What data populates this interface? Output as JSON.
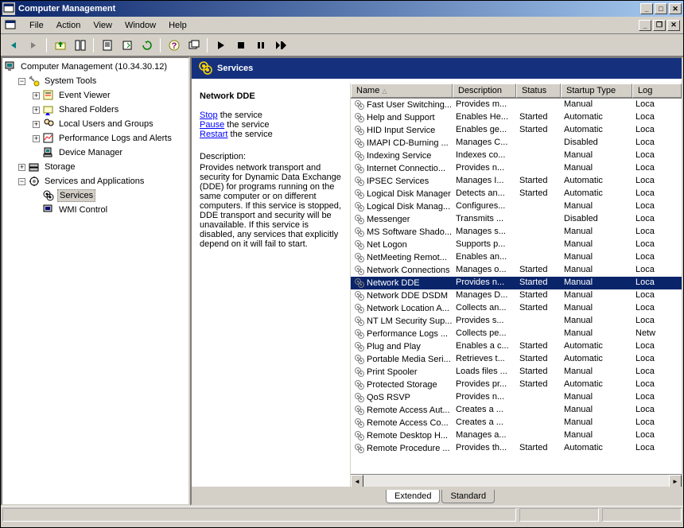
{
  "window": {
    "title": "Computer Management"
  },
  "mdi": {
    "minimize": "_",
    "restore": "❐",
    "close": "✕"
  },
  "titlebar_buttons": {
    "minimize": "_",
    "maximize": "□",
    "close": "✕"
  },
  "menu": {
    "file": "File",
    "action": "Action",
    "view": "View",
    "window": "Window",
    "help": "Help"
  },
  "tree": {
    "root": "Computer Management (10.34.30.12)",
    "system_tools": "System Tools",
    "event_viewer": "Event Viewer",
    "shared_folders": "Shared Folders",
    "local_users": "Local Users and Groups",
    "perf_logs": "Performance Logs and Alerts",
    "device_mgr": "Device Manager",
    "storage": "Storage",
    "services_apps": "Services and Applications",
    "services": "Services",
    "wmi": "WMI Control"
  },
  "header": {
    "title": "Services"
  },
  "detail": {
    "title": "Network DDE",
    "stop": "Stop",
    "stop_suffix": " the service",
    "pause": "Pause",
    "pause_suffix": " the service",
    "restart": "Restart",
    "restart_suffix": " the service",
    "desc_label": "Description:",
    "description": "Provides network transport and security for Dynamic Data Exchange (DDE) for programs running on the same computer or on different computers. If this service is stopped, DDE transport and security will be unavailable. If this service is disabled, any services that explicitly depend on it will fail to start."
  },
  "columns": {
    "name": "Name",
    "description": "Description",
    "status": "Status",
    "startup": "Startup Type",
    "logon": "Log"
  },
  "tabs": {
    "extended": "Extended",
    "standard": "Standard"
  },
  "services": [
    {
      "name": "Fast User Switching...",
      "desc": "Provides m...",
      "status": "",
      "startup": "Manual",
      "logon": "Loca"
    },
    {
      "name": "Help and Support",
      "desc": "Enables He...",
      "status": "Started",
      "startup": "Automatic",
      "logon": "Loca"
    },
    {
      "name": "HID Input Service",
      "desc": "Enables ge...",
      "status": "Started",
      "startup": "Automatic",
      "logon": "Loca"
    },
    {
      "name": "IMAPI CD-Burning ...",
      "desc": "Manages C...",
      "status": "",
      "startup": "Disabled",
      "logon": "Loca"
    },
    {
      "name": "Indexing Service",
      "desc": "Indexes co...",
      "status": "",
      "startup": "Manual",
      "logon": "Loca"
    },
    {
      "name": "Internet Connectio...",
      "desc": "Provides n...",
      "status": "",
      "startup": "Manual",
      "logon": "Loca"
    },
    {
      "name": "IPSEC Services",
      "desc": "Manages I...",
      "status": "Started",
      "startup": "Automatic",
      "logon": "Loca"
    },
    {
      "name": "Logical Disk Manager",
      "desc": "Detects an...",
      "status": "Started",
      "startup": "Automatic",
      "logon": "Loca"
    },
    {
      "name": "Logical Disk Manag...",
      "desc": "Configures...",
      "status": "",
      "startup": "Manual",
      "logon": "Loca"
    },
    {
      "name": "Messenger",
      "desc": "Transmits ...",
      "status": "",
      "startup": "Disabled",
      "logon": "Loca"
    },
    {
      "name": "MS Software Shado...",
      "desc": "Manages s...",
      "status": "",
      "startup": "Manual",
      "logon": "Loca"
    },
    {
      "name": "Net Logon",
      "desc": "Supports p...",
      "status": "",
      "startup": "Manual",
      "logon": "Loca"
    },
    {
      "name": "NetMeeting Remot...",
      "desc": "Enables an...",
      "status": "",
      "startup": "Manual",
      "logon": "Loca"
    },
    {
      "name": "Network Connections",
      "desc": "Manages o...",
      "status": "Started",
      "startup": "Manual",
      "logon": "Loca"
    },
    {
      "name": "Network DDE",
      "desc": "Provides n...",
      "status": "Started",
      "startup": "Manual",
      "logon": "Loca",
      "selected": true
    },
    {
      "name": "Network DDE DSDM",
      "desc": "Manages D...",
      "status": "Started",
      "startup": "Manual",
      "logon": "Loca"
    },
    {
      "name": "Network Location A...",
      "desc": "Collects an...",
      "status": "Started",
      "startup": "Manual",
      "logon": "Loca"
    },
    {
      "name": "NT LM Security Sup...",
      "desc": "Provides s...",
      "status": "",
      "startup": "Manual",
      "logon": "Loca"
    },
    {
      "name": "Performance Logs ...",
      "desc": "Collects pe...",
      "status": "",
      "startup": "Manual",
      "logon": "Netw"
    },
    {
      "name": "Plug and Play",
      "desc": "Enables a c...",
      "status": "Started",
      "startup": "Automatic",
      "logon": "Loca"
    },
    {
      "name": "Portable Media Seri...",
      "desc": "Retrieves t...",
      "status": "Started",
      "startup": "Automatic",
      "logon": "Loca"
    },
    {
      "name": "Print Spooler",
      "desc": "Loads files ...",
      "status": "Started",
      "startup": "Manual",
      "logon": "Loca"
    },
    {
      "name": "Protected Storage",
      "desc": "Provides pr...",
      "status": "Started",
      "startup": "Automatic",
      "logon": "Loca"
    },
    {
      "name": "QoS RSVP",
      "desc": "Provides n...",
      "status": "",
      "startup": "Manual",
      "logon": "Loca"
    },
    {
      "name": "Remote Access Aut...",
      "desc": "Creates a ...",
      "status": "",
      "startup": "Manual",
      "logon": "Loca"
    },
    {
      "name": "Remote Access Co...",
      "desc": "Creates a ...",
      "status": "",
      "startup": "Manual",
      "logon": "Loca"
    },
    {
      "name": "Remote Desktop H...",
      "desc": "Manages a...",
      "status": "",
      "startup": "Manual",
      "logon": "Loca"
    },
    {
      "name": "Remote Procedure ...",
      "desc": "Provides th...",
      "status": "Started",
      "startup": "Automatic",
      "logon": "Loca"
    }
  ]
}
